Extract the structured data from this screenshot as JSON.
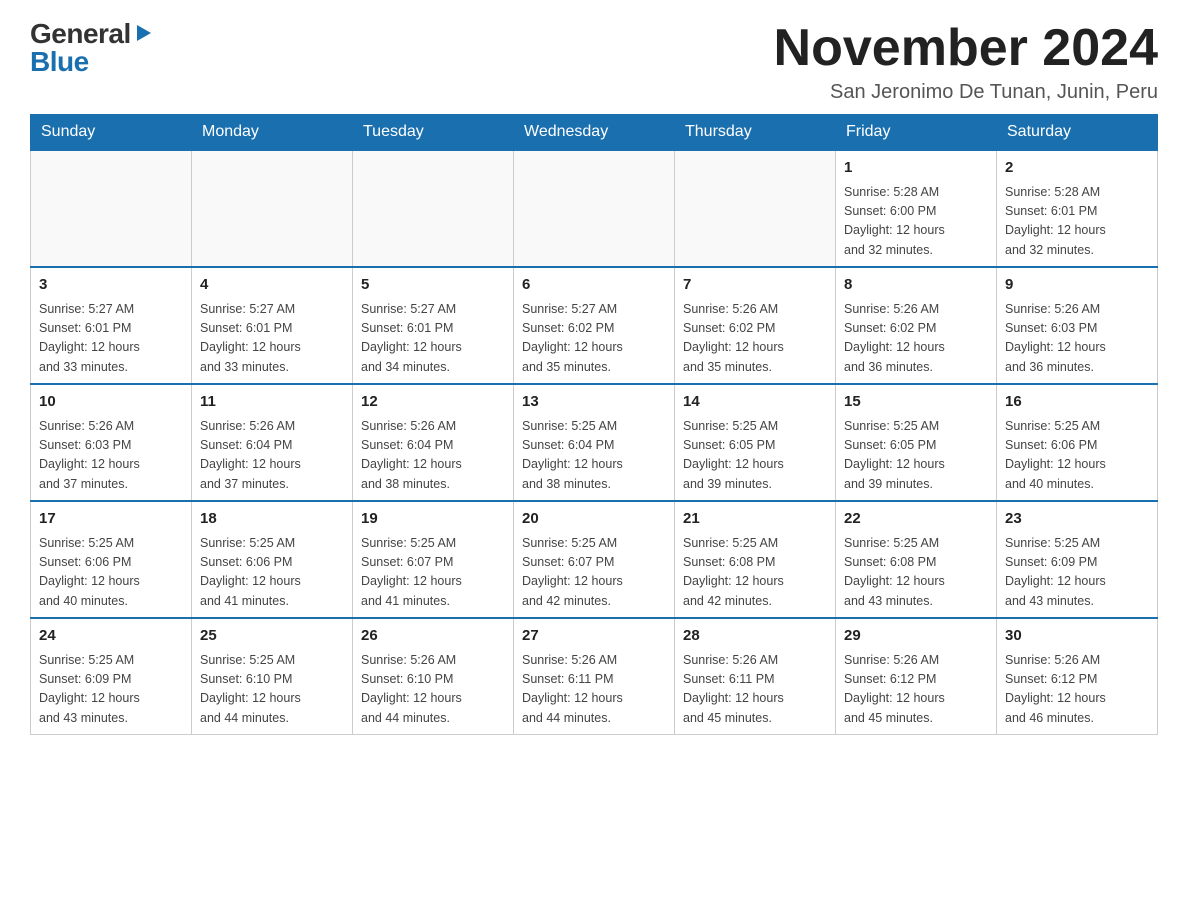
{
  "logo": {
    "general": "General",
    "blue": "Blue"
  },
  "header": {
    "month_title": "November 2024",
    "location": "San Jeronimo De Tunan, Junin, Peru"
  },
  "days_of_week": [
    "Sunday",
    "Monday",
    "Tuesday",
    "Wednesday",
    "Thursday",
    "Friday",
    "Saturday"
  ],
  "weeks": [
    [
      {
        "day": "",
        "info": ""
      },
      {
        "day": "",
        "info": ""
      },
      {
        "day": "",
        "info": ""
      },
      {
        "day": "",
        "info": ""
      },
      {
        "day": "",
        "info": ""
      },
      {
        "day": "1",
        "info": "Sunrise: 5:28 AM\nSunset: 6:00 PM\nDaylight: 12 hours\nand 32 minutes."
      },
      {
        "day": "2",
        "info": "Sunrise: 5:28 AM\nSunset: 6:01 PM\nDaylight: 12 hours\nand 32 minutes."
      }
    ],
    [
      {
        "day": "3",
        "info": "Sunrise: 5:27 AM\nSunset: 6:01 PM\nDaylight: 12 hours\nand 33 minutes."
      },
      {
        "day": "4",
        "info": "Sunrise: 5:27 AM\nSunset: 6:01 PM\nDaylight: 12 hours\nand 33 minutes."
      },
      {
        "day": "5",
        "info": "Sunrise: 5:27 AM\nSunset: 6:01 PM\nDaylight: 12 hours\nand 34 minutes."
      },
      {
        "day": "6",
        "info": "Sunrise: 5:27 AM\nSunset: 6:02 PM\nDaylight: 12 hours\nand 35 minutes."
      },
      {
        "day": "7",
        "info": "Sunrise: 5:26 AM\nSunset: 6:02 PM\nDaylight: 12 hours\nand 35 minutes."
      },
      {
        "day": "8",
        "info": "Sunrise: 5:26 AM\nSunset: 6:02 PM\nDaylight: 12 hours\nand 36 minutes."
      },
      {
        "day": "9",
        "info": "Sunrise: 5:26 AM\nSunset: 6:03 PM\nDaylight: 12 hours\nand 36 minutes."
      }
    ],
    [
      {
        "day": "10",
        "info": "Sunrise: 5:26 AM\nSunset: 6:03 PM\nDaylight: 12 hours\nand 37 minutes."
      },
      {
        "day": "11",
        "info": "Sunrise: 5:26 AM\nSunset: 6:04 PM\nDaylight: 12 hours\nand 37 minutes."
      },
      {
        "day": "12",
        "info": "Sunrise: 5:26 AM\nSunset: 6:04 PM\nDaylight: 12 hours\nand 38 minutes."
      },
      {
        "day": "13",
        "info": "Sunrise: 5:25 AM\nSunset: 6:04 PM\nDaylight: 12 hours\nand 38 minutes."
      },
      {
        "day": "14",
        "info": "Sunrise: 5:25 AM\nSunset: 6:05 PM\nDaylight: 12 hours\nand 39 minutes."
      },
      {
        "day": "15",
        "info": "Sunrise: 5:25 AM\nSunset: 6:05 PM\nDaylight: 12 hours\nand 39 minutes."
      },
      {
        "day": "16",
        "info": "Sunrise: 5:25 AM\nSunset: 6:06 PM\nDaylight: 12 hours\nand 40 minutes."
      }
    ],
    [
      {
        "day": "17",
        "info": "Sunrise: 5:25 AM\nSunset: 6:06 PM\nDaylight: 12 hours\nand 40 minutes."
      },
      {
        "day": "18",
        "info": "Sunrise: 5:25 AM\nSunset: 6:06 PM\nDaylight: 12 hours\nand 41 minutes."
      },
      {
        "day": "19",
        "info": "Sunrise: 5:25 AM\nSunset: 6:07 PM\nDaylight: 12 hours\nand 41 minutes."
      },
      {
        "day": "20",
        "info": "Sunrise: 5:25 AM\nSunset: 6:07 PM\nDaylight: 12 hours\nand 42 minutes."
      },
      {
        "day": "21",
        "info": "Sunrise: 5:25 AM\nSunset: 6:08 PM\nDaylight: 12 hours\nand 42 minutes."
      },
      {
        "day": "22",
        "info": "Sunrise: 5:25 AM\nSunset: 6:08 PM\nDaylight: 12 hours\nand 43 minutes."
      },
      {
        "day": "23",
        "info": "Sunrise: 5:25 AM\nSunset: 6:09 PM\nDaylight: 12 hours\nand 43 minutes."
      }
    ],
    [
      {
        "day": "24",
        "info": "Sunrise: 5:25 AM\nSunset: 6:09 PM\nDaylight: 12 hours\nand 43 minutes."
      },
      {
        "day": "25",
        "info": "Sunrise: 5:25 AM\nSunset: 6:10 PM\nDaylight: 12 hours\nand 44 minutes."
      },
      {
        "day": "26",
        "info": "Sunrise: 5:26 AM\nSunset: 6:10 PM\nDaylight: 12 hours\nand 44 minutes."
      },
      {
        "day": "27",
        "info": "Sunrise: 5:26 AM\nSunset: 6:11 PM\nDaylight: 12 hours\nand 44 minutes."
      },
      {
        "day": "28",
        "info": "Sunrise: 5:26 AM\nSunset: 6:11 PM\nDaylight: 12 hours\nand 45 minutes."
      },
      {
        "day": "29",
        "info": "Sunrise: 5:26 AM\nSunset: 6:12 PM\nDaylight: 12 hours\nand 45 minutes."
      },
      {
        "day": "30",
        "info": "Sunrise: 5:26 AM\nSunset: 6:12 PM\nDaylight: 12 hours\nand 46 minutes."
      }
    ]
  ]
}
